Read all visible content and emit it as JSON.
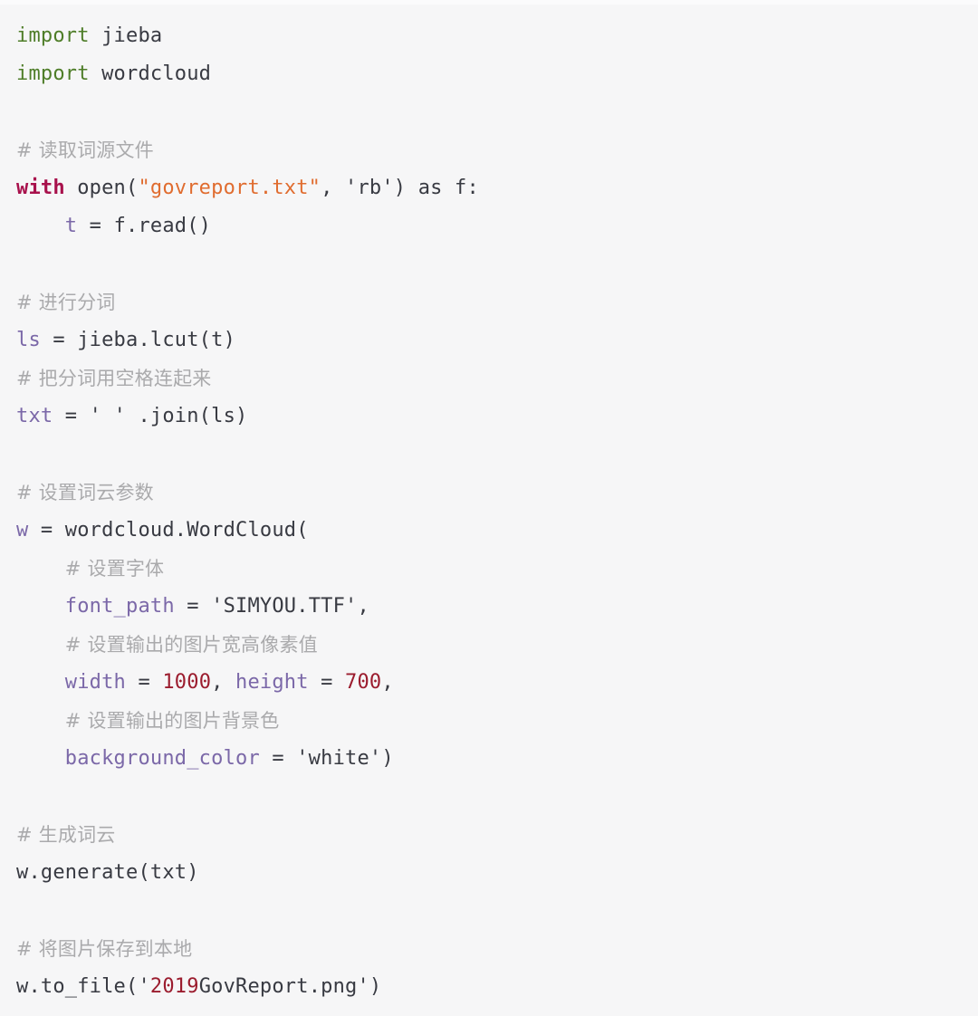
{
  "editor": {
    "language": "python",
    "background_color": "#f6f6f7",
    "default_text_color": "#383a42",
    "comment_color": "#aaaaac",
    "keyword_color": "#4e7d28",
    "keyword_strong_color": "#a8114c",
    "variable_color": "#7b68a8",
    "string_color": "#e06c2f",
    "number_color": "#9b1c2e",
    "font_size_px": 22,
    "line_height_px": 42
  },
  "code": {
    "lines": [
      {
        "index": 1,
        "text": "import jieba",
        "tokens": [
          {
            "t": "import",
            "k": "keyword"
          },
          {
            "t": " jieba",
            "k": "default"
          }
        ]
      },
      {
        "index": 2,
        "text": "import wordcloud",
        "tokens": [
          {
            "t": "import",
            "k": "keyword"
          },
          {
            "t": " wordcloud",
            "k": "default"
          }
        ]
      },
      {
        "index": 3,
        "text": "",
        "tokens": []
      },
      {
        "index": 4,
        "text": "# 读取词源文件",
        "tokens": [
          {
            "t": "# 读取词源文件",
            "k": "comment"
          }
        ]
      },
      {
        "index": 5,
        "text": "with open(\"govreport.txt\", 'rb') as f:",
        "tokens": [
          {
            "t": "with",
            "k": "kw-strong"
          },
          {
            "t": " open(",
            "k": "default"
          },
          {
            "t": "\"govreport.txt\"",
            "k": "string"
          },
          {
            "t": ", 'rb') as f:",
            "k": "default"
          }
        ]
      },
      {
        "index": 6,
        "text": "    t = f.read()",
        "tokens": [
          {
            "t": "    ",
            "k": "default"
          },
          {
            "t": "t",
            "k": "var"
          },
          {
            "t": " = f.read()",
            "k": "default"
          }
        ]
      },
      {
        "index": 7,
        "text": "",
        "tokens": []
      },
      {
        "index": 8,
        "text": "# 进行分词",
        "tokens": [
          {
            "t": "# 进行分词",
            "k": "comment"
          }
        ]
      },
      {
        "index": 9,
        "text": "ls = jieba.lcut(t)",
        "tokens": [
          {
            "t": "ls",
            "k": "var"
          },
          {
            "t": " = jieba.lcut(t)",
            "k": "default"
          }
        ]
      },
      {
        "index": 10,
        "text": "# 把分词用空格连起来",
        "tokens": [
          {
            "t": "# 把分词用空格连起来",
            "k": "comment"
          }
        ]
      },
      {
        "index": 11,
        "text": "txt = ' ' .join(ls)",
        "tokens": [
          {
            "t": "txt",
            "k": "var"
          },
          {
            "t": " = ' ' .join(ls)",
            "k": "default"
          }
        ]
      },
      {
        "index": 12,
        "text": "",
        "tokens": []
      },
      {
        "index": 13,
        "text": "# 设置词云参数",
        "tokens": [
          {
            "t": "# 设置词云参数",
            "k": "comment"
          }
        ]
      },
      {
        "index": 14,
        "text": "w = wordcloud.WordCloud(",
        "tokens": [
          {
            "t": "w",
            "k": "var"
          },
          {
            "t": " = wordcloud.WordCloud(",
            "k": "default"
          }
        ]
      },
      {
        "index": 15,
        "text": "    # 设置字体",
        "tokens": [
          {
            "t": "    ",
            "k": "default"
          },
          {
            "t": "# 设置字体",
            "k": "comment"
          }
        ]
      },
      {
        "index": 16,
        "text": "    font_path = 'SIMYOU.TTF',",
        "tokens": [
          {
            "t": "    ",
            "k": "default"
          },
          {
            "t": "font_path",
            "k": "var"
          },
          {
            "t": " = 'SIMYOU.TTF',",
            "k": "default"
          }
        ]
      },
      {
        "index": 17,
        "text": "    # 设置输出的图片宽高像素值",
        "tokens": [
          {
            "t": "    ",
            "k": "default"
          },
          {
            "t": "# 设置输出的图片宽高像素值",
            "k": "comment"
          }
        ]
      },
      {
        "index": 18,
        "text": "    width = 1000, height = 700,",
        "tokens": [
          {
            "t": "    ",
            "k": "default"
          },
          {
            "t": "width",
            "k": "var"
          },
          {
            "t": " = ",
            "k": "default"
          },
          {
            "t": "1000",
            "k": "number"
          },
          {
            "t": ", ",
            "k": "default"
          },
          {
            "t": "height",
            "k": "var"
          },
          {
            "t": " = ",
            "k": "default"
          },
          {
            "t": "700",
            "k": "number"
          },
          {
            "t": ",",
            "k": "default"
          }
        ]
      },
      {
        "index": 19,
        "text": "    # 设置输出的图片背景色",
        "tokens": [
          {
            "t": "    ",
            "k": "default"
          },
          {
            "t": "# 设置输出的图片背景色",
            "k": "comment"
          }
        ]
      },
      {
        "index": 20,
        "text": "    background_color = 'white')",
        "tokens": [
          {
            "t": "    ",
            "k": "default"
          },
          {
            "t": "background_color",
            "k": "var"
          },
          {
            "t": " = 'white')",
            "k": "default"
          }
        ]
      },
      {
        "index": 21,
        "text": "",
        "tokens": []
      },
      {
        "index": 22,
        "text": "# 生成词云",
        "tokens": [
          {
            "t": "# 生成词云",
            "k": "comment"
          }
        ]
      },
      {
        "index": 23,
        "text": "w.generate(txt)",
        "tokens": [
          {
            "t": "w.generate(txt)",
            "k": "default"
          }
        ]
      },
      {
        "index": 24,
        "text": "",
        "tokens": []
      },
      {
        "index": 25,
        "text": "# 将图片保存到本地",
        "tokens": [
          {
            "t": "# 将图片保存到本地",
            "k": "comment"
          }
        ]
      },
      {
        "index": 26,
        "text": "w.to_file('2019GovReport.png')",
        "tokens": [
          {
            "t": "w.to_file('",
            "k": "default"
          },
          {
            "t": "2019",
            "k": "number"
          },
          {
            "t": "GovReport.png')",
            "k": "default"
          }
        ]
      }
    ]
  }
}
